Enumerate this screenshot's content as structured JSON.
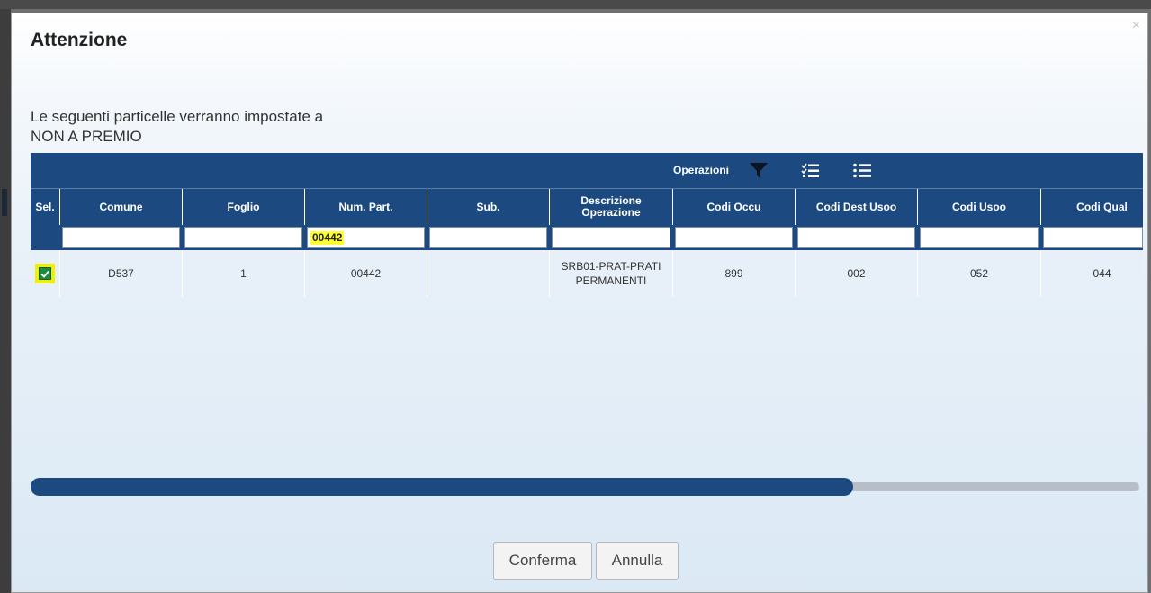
{
  "dialog": {
    "title": "Attenzione",
    "close_symbol": "×",
    "message_line1": "Le seguenti particelle verranno impostate a",
    "message_line2": "NON A PREMIO"
  },
  "toolbar": {
    "label": "Operazioni",
    "icons": [
      "filter-icon",
      "checklist-icon",
      "list-icon"
    ]
  },
  "grid": {
    "columns": [
      "Sel.",
      "Comune",
      "Foglio",
      "Num. Part.",
      "Sub.",
      "Descrizione Operazione",
      "Codi Occu",
      "Codi Dest Usoo",
      "Codi Usoo",
      "Codi Qual"
    ],
    "filters": {
      "comune": "",
      "foglio": "",
      "num_part": "00442",
      "sub": "",
      "descrizione": "",
      "codi_occu": "",
      "codi_dest_usoo": "",
      "codi_usoo": "",
      "codi_qual": ""
    },
    "rows": [
      {
        "selected": true,
        "comune": "D537",
        "foglio": "1",
        "num_part": "00442",
        "sub": "",
        "descrizione_line1": "SRB01-PRAT-PRATI",
        "descrizione_line2": "PERMANENTI",
        "codi_occu": "899",
        "codi_dest_usoo": "002",
        "codi_usoo": "052",
        "codi_qual": "044"
      }
    ]
  },
  "scrollbar": {
    "position_fraction": 0.74
  },
  "buttons": {
    "confirm": "Conferma",
    "cancel": "Annulla"
  },
  "colors": {
    "header": "#1c4a80",
    "highlight": "#ffff33",
    "check": "#1e8a3e"
  }
}
